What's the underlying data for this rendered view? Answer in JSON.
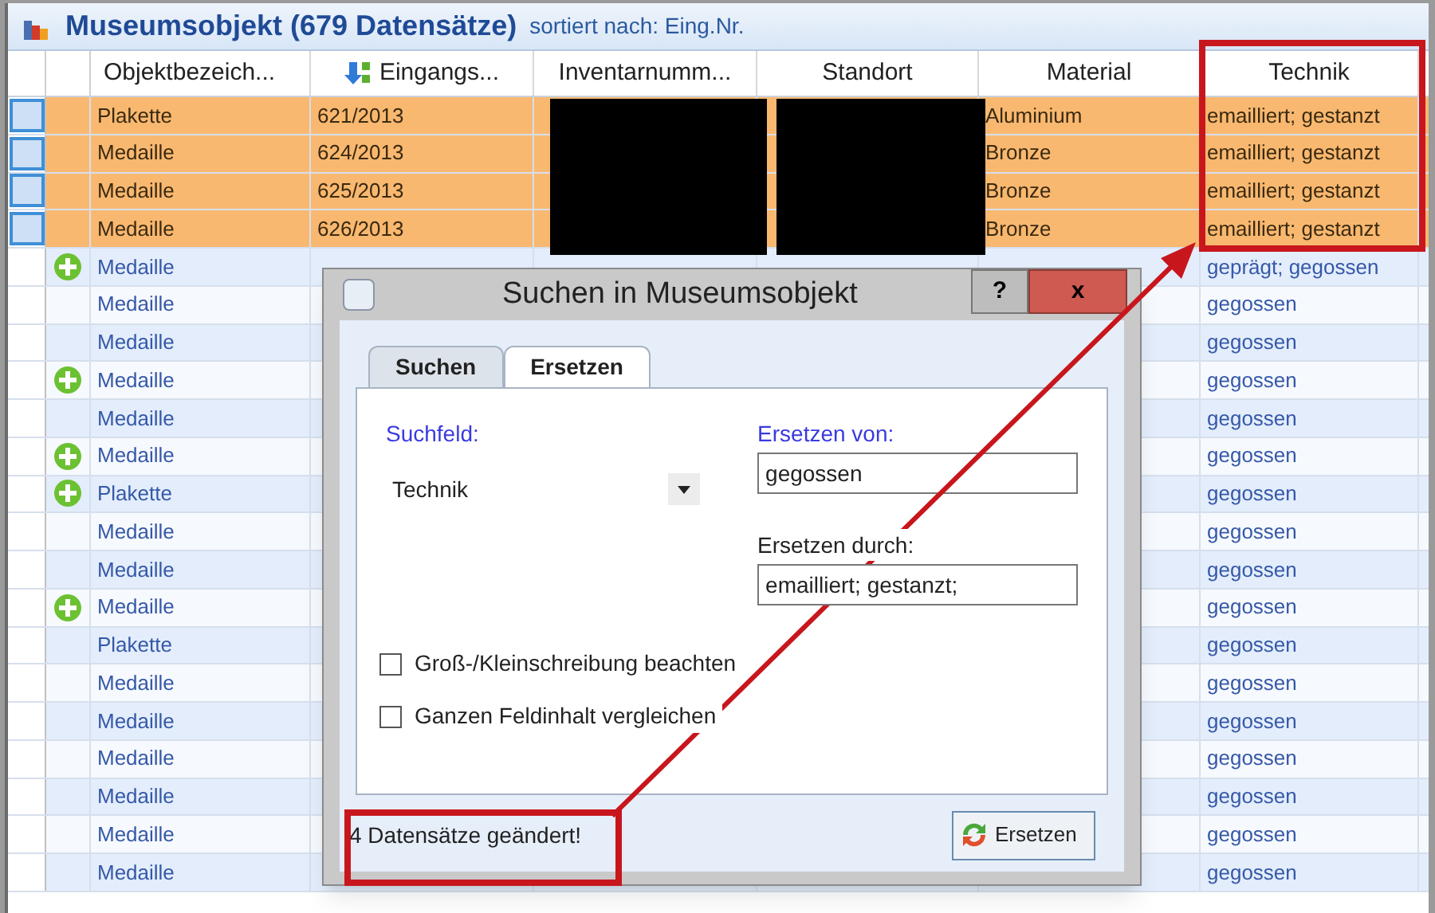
{
  "header": {
    "title": "Museumsobjekt (679 Datensätze)",
    "sort_note": "sortiert nach: Eing.Nr."
  },
  "table": {
    "columns": [
      {
        "label": "Objektbezeich...",
        "sorted": false
      },
      {
        "label": "Eingangs...",
        "sorted": true
      },
      {
        "label": "Inventarnumm...",
        "sorted": false
      },
      {
        "label": "Standort",
        "sorted": false
      },
      {
        "label": "Material",
        "sorted": false
      },
      {
        "label": "Technik",
        "sorted": false
      }
    ],
    "rows": [
      {
        "selected": true,
        "added": false,
        "objekt": "Plakette",
        "eingang": "621/2013",
        "material": "Aluminium",
        "technik": "emailliert; gestanzt"
      },
      {
        "selected": true,
        "added": false,
        "objekt": "Medaille",
        "eingang": "624/2013",
        "material": "Bronze",
        "technik": "emailliert; gestanzt"
      },
      {
        "selected": true,
        "added": false,
        "objekt": "Medaille",
        "eingang": "625/2013",
        "material": "Bronze",
        "technik": "emailliert; gestanzt"
      },
      {
        "selected": true,
        "added": false,
        "objekt": "Medaille",
        "eingang": "626/2013",
        "material": "Bronze",
        "technik": "emailliert; gestanzt"
      },
      {
        "selected": false,
        "added": true,
        "objekt": "Medaille",
        "technik": "geprägt; gegossen"
      },
      {
        "selected": false,
        "added": false,
        "objekt": "Medaille",
        "technik": "gegossen"
      },
      {
        "selected": false,
        "added": false,
        "objekt": "Medaille",
        "technik": "gegossen"
      },
      {
        "selected": false,
        "added": true,
        "objekt": "Medaille",
        "technik": "gegossen"
      },
      {
        "selected": false,
        "added": false,
        "objekt": "Medaille",
        "technik": "gegossen"
      },
      {
        "selected": false,
        "added": true,
        "objekt": "Medaille",
        "technik": "gegossen"
      },
      {
        "selected": false,
        "added": true,
        "objekt": "Plakette",
        "technik": "gegossen"
      },
      {
        "selected": false,
        "added": false,
        "objekt": "Medaille",
        "technik": "gegossen"
      },
      {
        "selected": false,
        "added": false,
        "objekt": "Medaille",
        "technik": "gegossen"
      },
      {
        "selected": false,
        "added": true,
        "objekt": "Medaille",
        "technik": "gegossen"
      },
      {
        "selected": false,
        "added": false,
        "objekt": "Plakette",
        "technik": "gegossen"
      },
      {
        "selected": false,
        "added": false,
        "objekt": "Medaille",
        "technik": "gegossen"
      },
      {
        "selected": false,
        "added": false,
        "objekt": "Medaille",
        "technik": "gegossen"
      },
      {
        "selected": false,
        "added": false,
        "objekt": "Medaille",
        "technik": "gegossen"
      },
      {
        "selected": false,
        "added": false,
        "objekt": "Medaille",
        "technik": "gegossen"
      },
      {
        "selected": false,
        "added": false,
        "objekt": "Medaille",
        "technik": "gegossen"
      },
      {
        "selected": false,
        "added": false,
        "objekt": "Medaille",
        "technik": "gegossen"
      }
    ]
  },
  "dialog": {
    "title": "Suchen in Museumsobjekt",
    "help": "?",
    "close": "x",
    "tabs": [
      {
        "label": "Suchen",
        "selected": false
      },
      {
        "label": "Ersetzen",
        "selected": true
      }
    ],
    "search_field_label": "Suchfeld:",
    "search_field_value": "Technik",
    "replace_from_label": "Ersetzen von:",
    "replace_from_value": "gegossen",
    "replace_with_label": "Ersetzen durch:",
    "replace_with_value": "emailliert; gestanzt;",
    "options": [
      {
        "label": "Groß-/Kleinschreibung beachten",
        "checked": false
      },
      {
        "label": "Ganzen Feldinhalt vergleichen",
        "checked": false
      }
    ],
    "status": "4 Datensätze geändert!",
    "replace_button": "Ersetzen"
  }
}
